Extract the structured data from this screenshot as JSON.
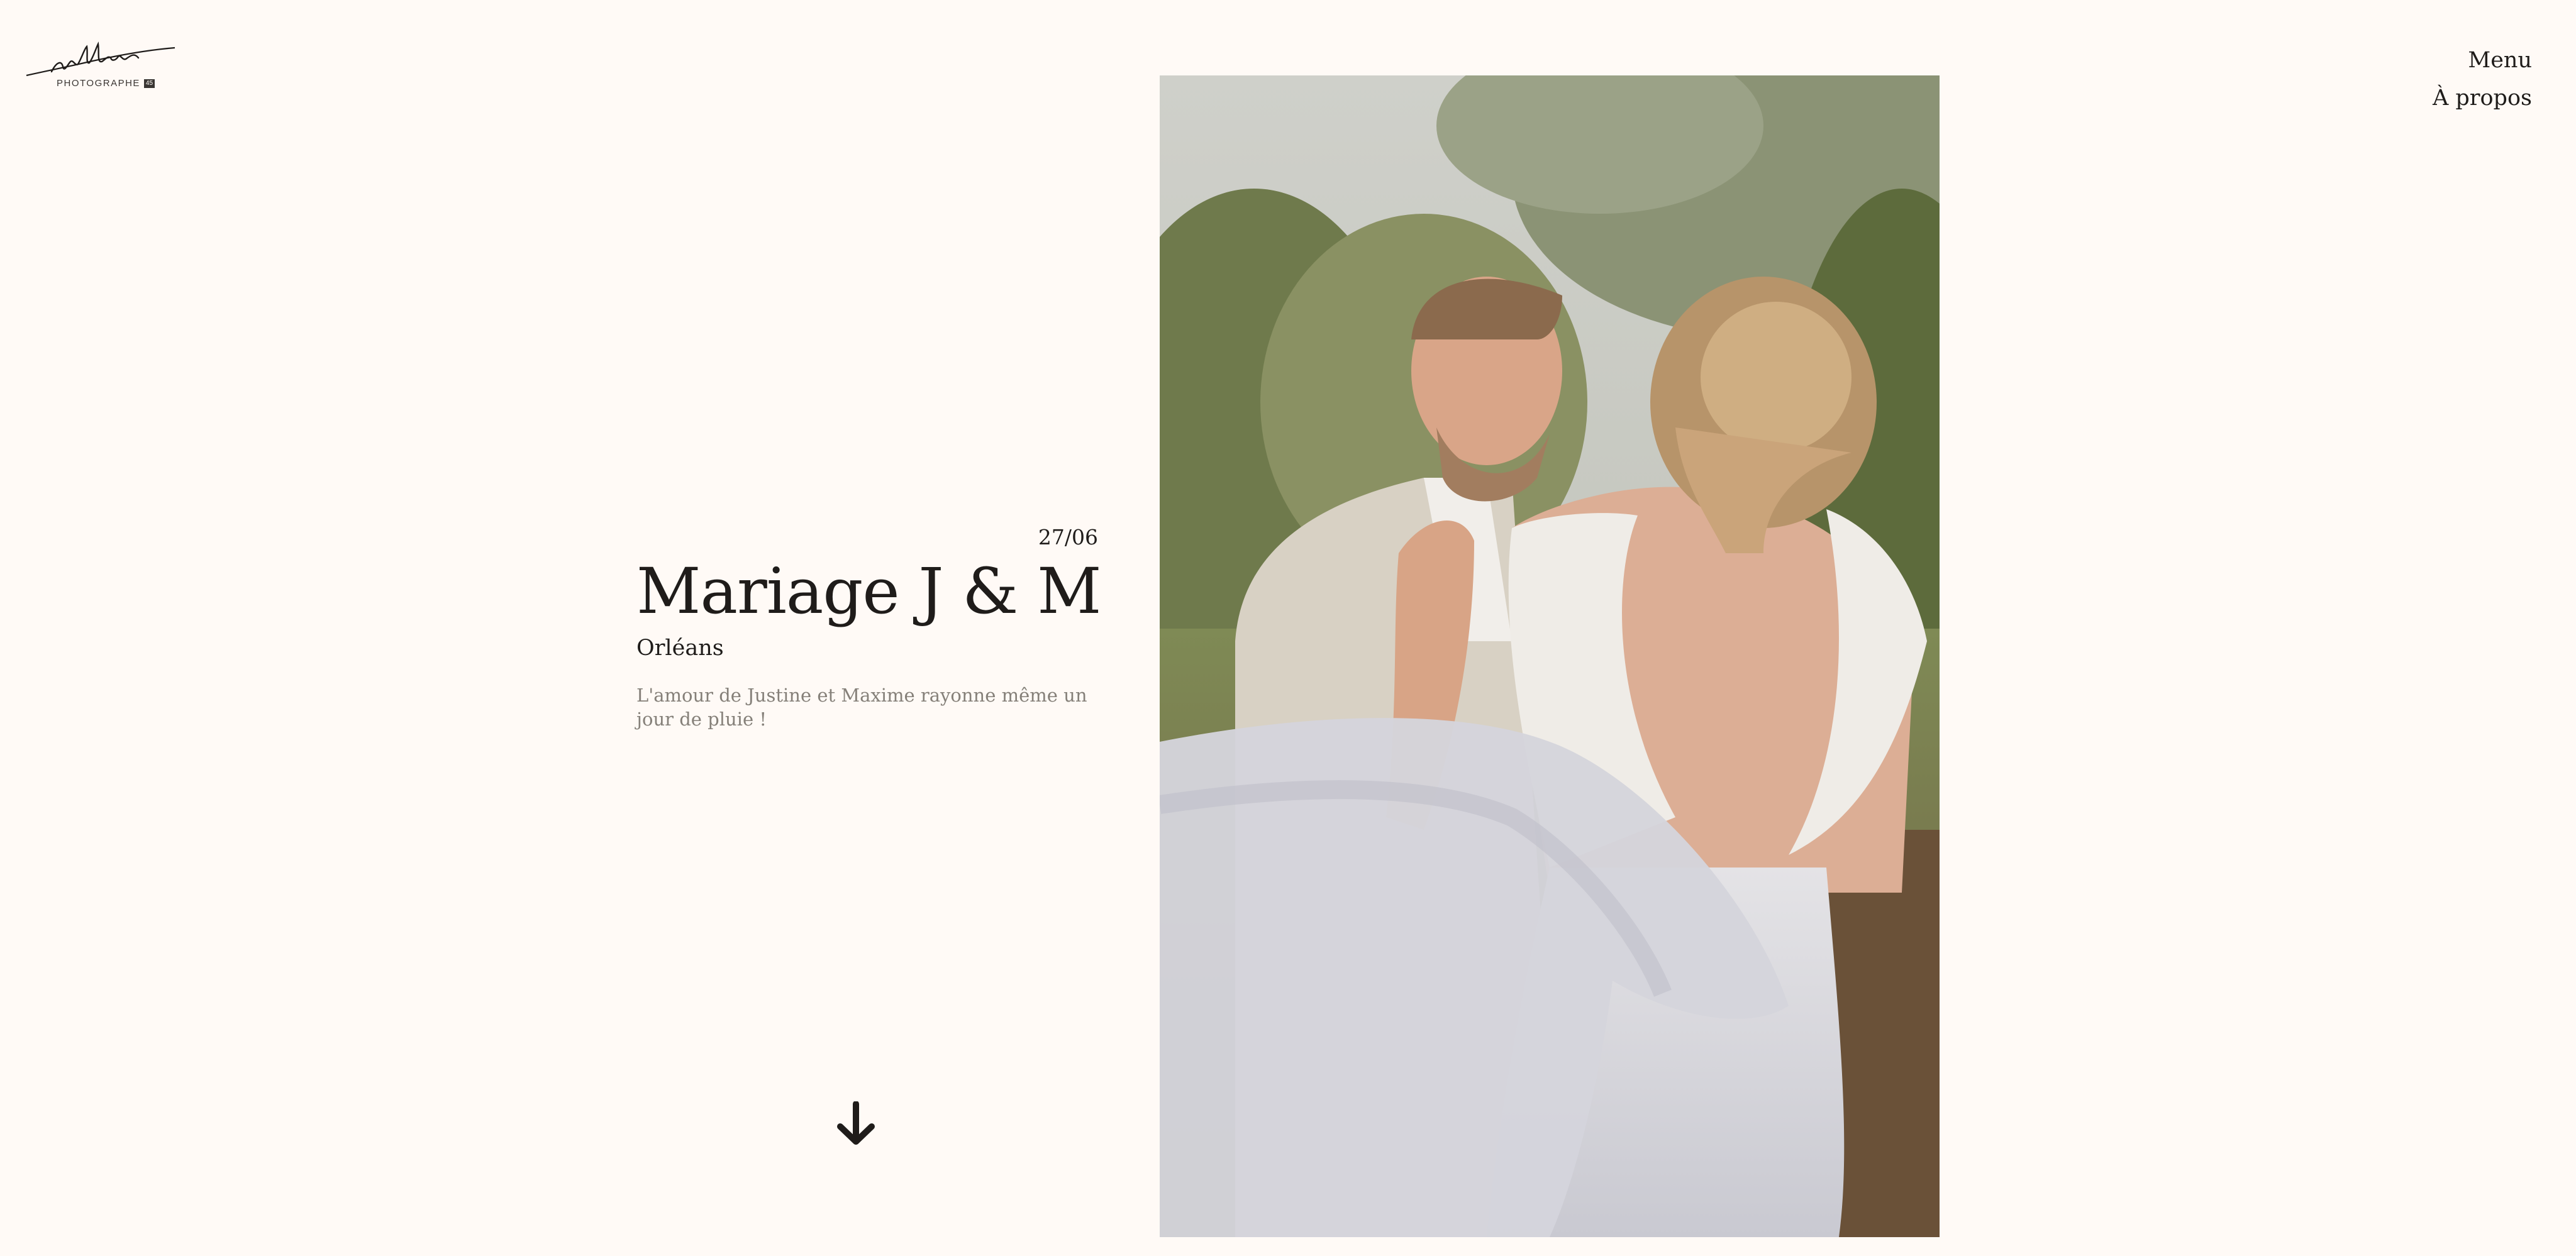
{
  "brand": {
    "logo_script": "nadline",
    "logo_subtitle": "PHOTOGRAPHE",
    "logo_badge": "45"
  },
  "nav": {
    "menu_label": "Menu",
    "about_label": "À propos"
  },
  "post": {
    "date": "27/06",
    "title": "Mariage J & M",
    "location": "Orléans",
    "description": "L'amour de Justine et Maxime rayonne même un jour de pluie !"
  },
  "icons": {
    "scroll": "arrow-down-icon"
  },
  "colors": {
    "background": "#fffaf6",
    "text": "#1f1c1a",
    "muted_text": "#858079"
  }
}
